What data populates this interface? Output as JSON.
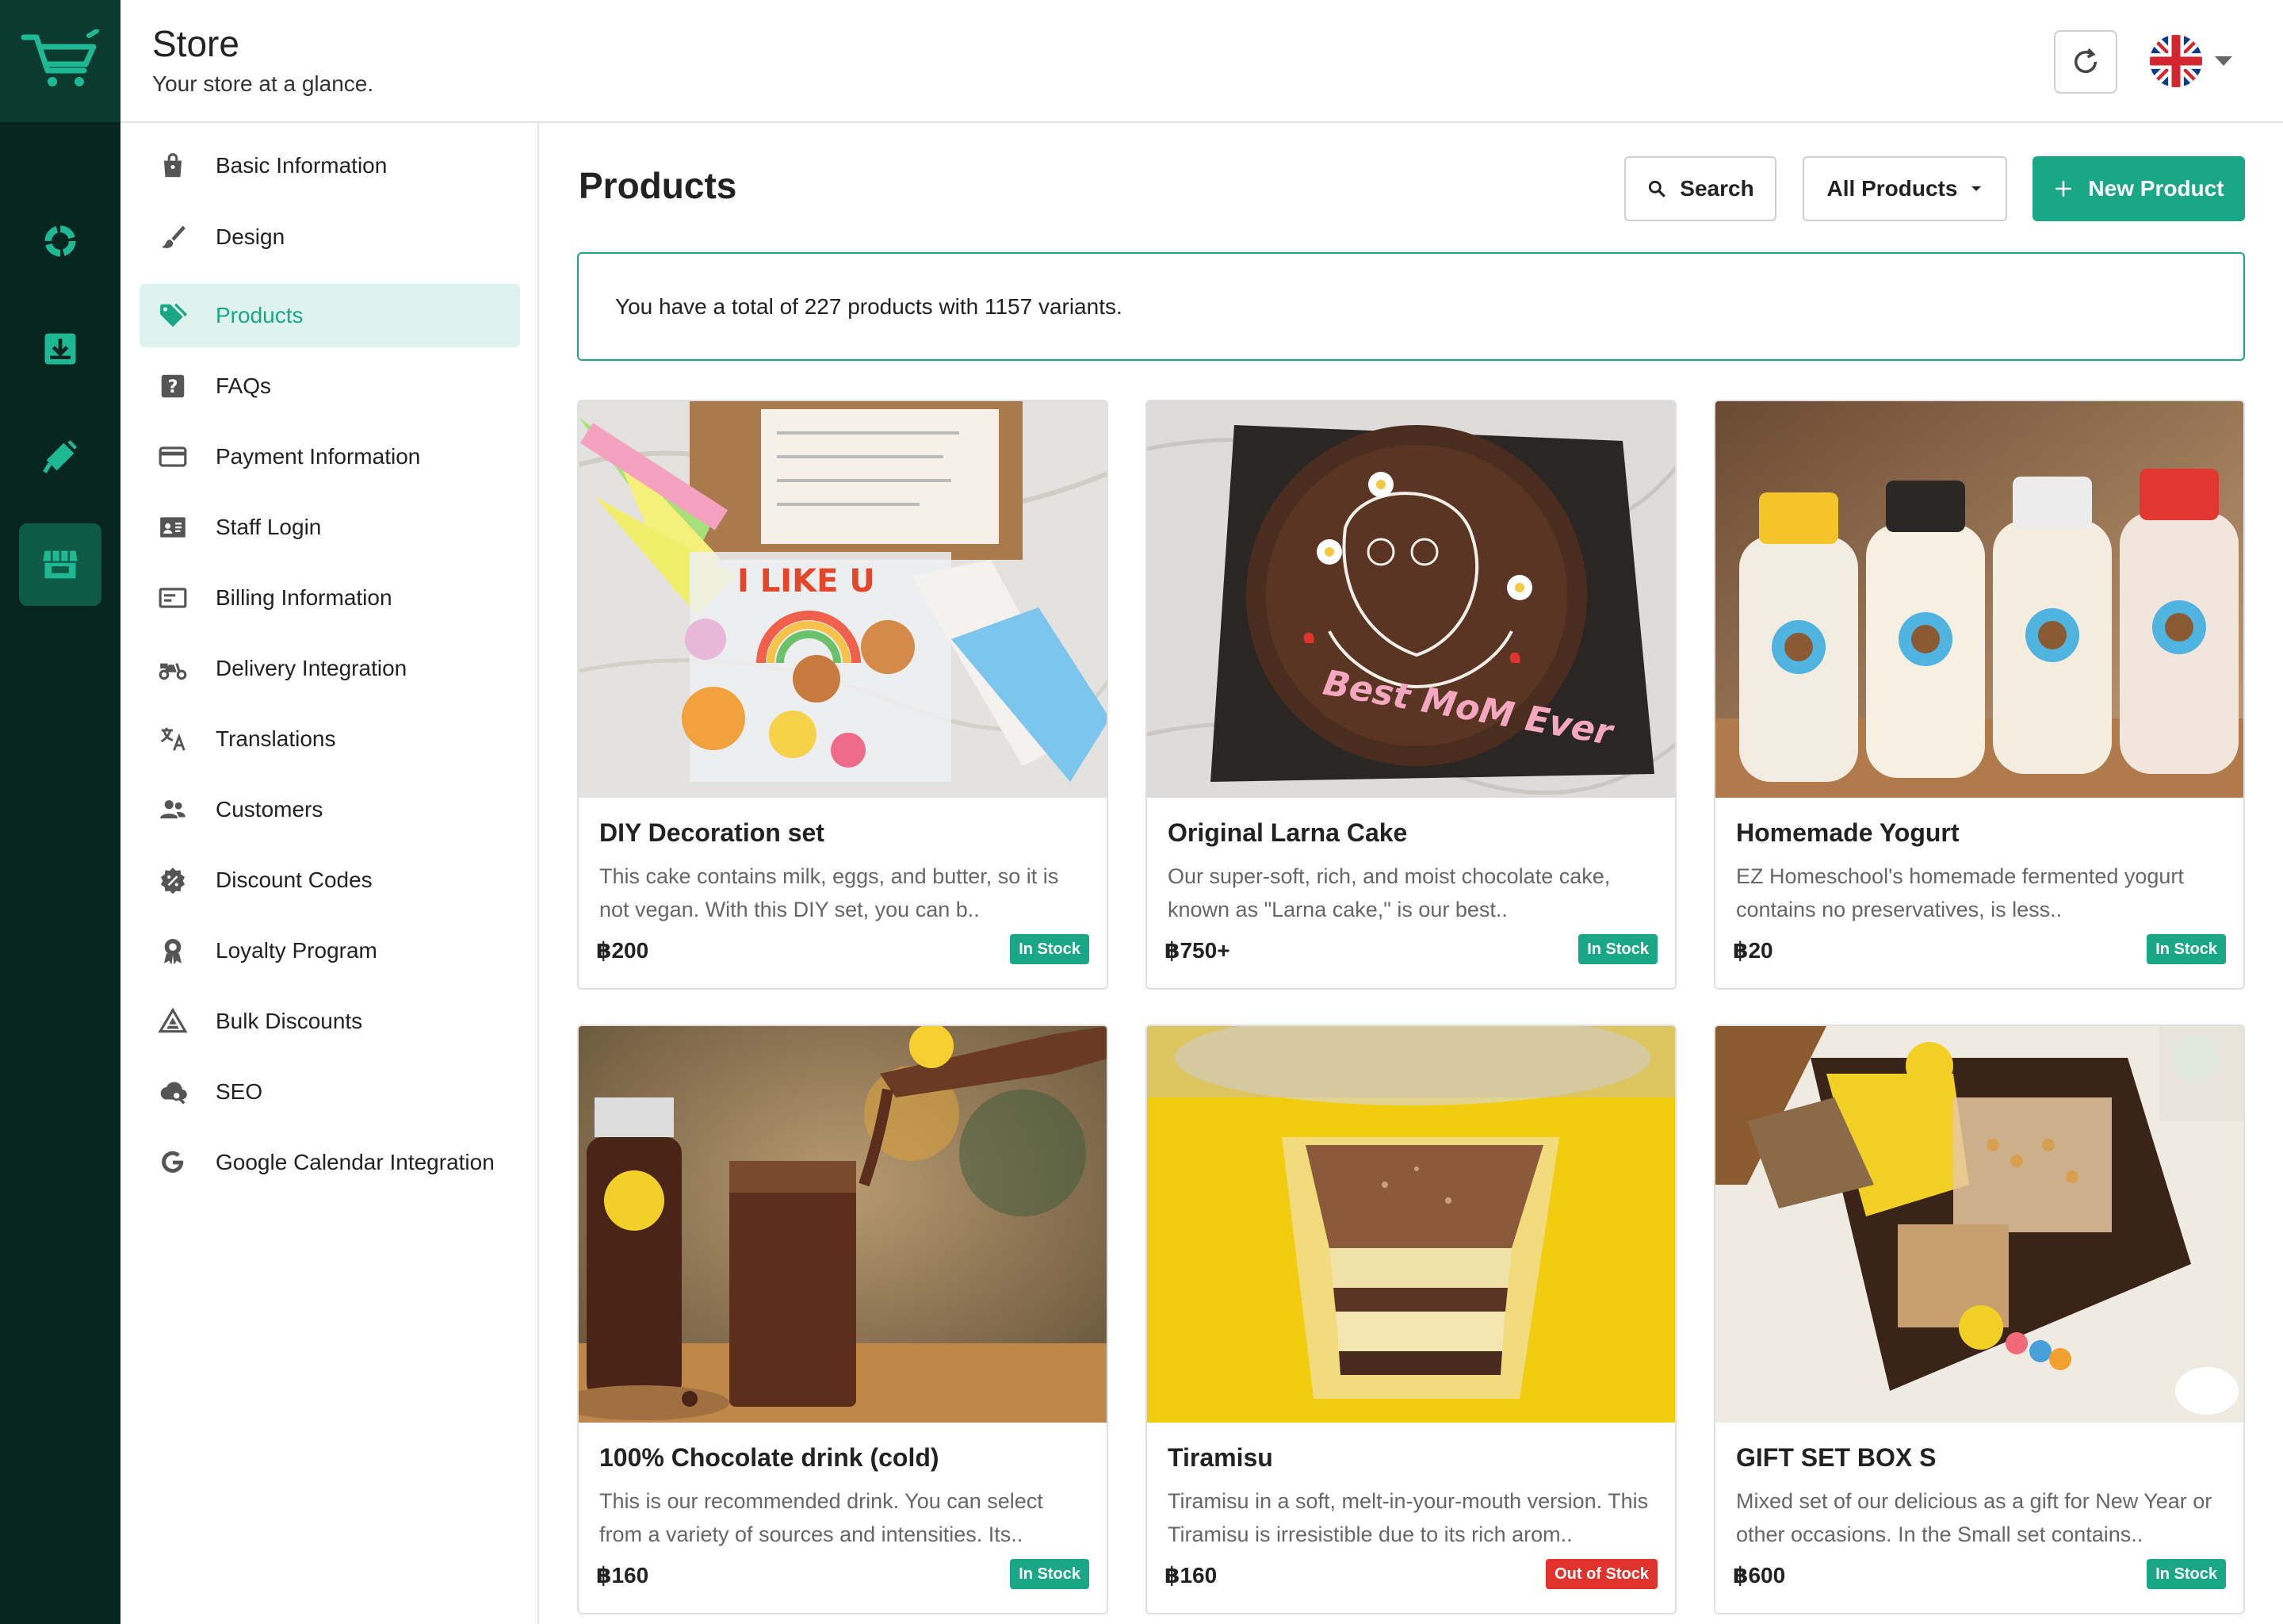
{
  "header": {
    "title": "Store",
    "subtitle": "Your store at a glance."
  },
  "sidebar": {
    "items": [
      {
        "label": "Basic Information",
        "icon": "bag-icon"
      },
      {
        "label": "Design",
        "icon": "brush-icon"
      },
      {
        "label": "Products",
        "icon": "tag-icon",
        "active": true
      },
      {
        "label": "FAQs",
        "icon": "question-icon"
      },
      {
        "label": "Payment Information",
        "icon": "credit-card-icon"
      },
      {
        "label": "Staff Login",
        "icon": "id-card-icon"
      },
      {
        "label": "Billing Information",
        "icon": "billing-card-icon"
      },
      {
        "label": "Delivery Integration",
        "icon": "scooter-icon"
      },
      {
        "label": "Translations",
        "icon": "translate-icon"
      },
      {
        "label": "Customers",
        "icon": "people-icon"
      },
      {
        "label": "Discount Codes",
        "icon": "discount-icon"
      },
      {
        "label": "Loyalty Program",
        "icon": "award-icon"
      },
      {
        "label": "Bulk Discounts",
        "icon": "pyramid-icon"
      },
      {
        "label": "SEO",
        "icon": "cloud-search-icon"
      },
      {
        "label": "Google Calendar Integration",
        "icon": "google-icon"
      }
    ]
  },
  "main": {
    "title": "Products",
    "search_label": "Search",
    "filter_label": "All Products",
    "new_label": "New Product",
    "summary": "You have a total of 227 products with 1157 variants."
  },
  "products": [
    {
      "name": "DIY Decoration set",
      "desc": "This cake contains milk, eggs, and butter, so it is not vegan. With this DIY set, you can b..",
      "price": "฿200",
      "status": "In Stock"
    },
    {
      "name": "Original Larna Cake",
      "desc": "Our super-soft, rich, and moist chocolate cake, known as \"Larna cake,\" is our best..",
      "price": "฿750+",
      "status": "In Stock"
    },
    {
      "name": "Homemade Yogurt",
      "desc": "EZ Homeschool's homemade fermented yogurt contains no preservatives, is less..",
      "price": "฿20",
      "status": "In Stock"
    },
    {
      "name": "100% Chocolate drink (cold)",
      "desc": "This is our recommended drink. You can select from a variety of sources and intensities. Its..",
      "price": "฿160",
      "status": "In Stock"
    },
    {
      "name": "Tiramisu",
      "desc": "Tiramisu in a soft, melt-in-your-mouth version. This Tiramisu is irresistible due to its rich arom..",
      "price": "฿160",
      "status": "Out of Stock"
    },
    {
      "name": "GIFT SET BOX S",
      "desc": "Mixed set of our delicious as a gift for New Year or other occasions. In the Small set contains..",
      "price": "฿600",
      "status": "In Stock"
    }
  ],
  "colors": {
    "accent": "#1aa786",
    "rail": "#06261f",
    "out_of_stock": "#e0332b"
  }
}
